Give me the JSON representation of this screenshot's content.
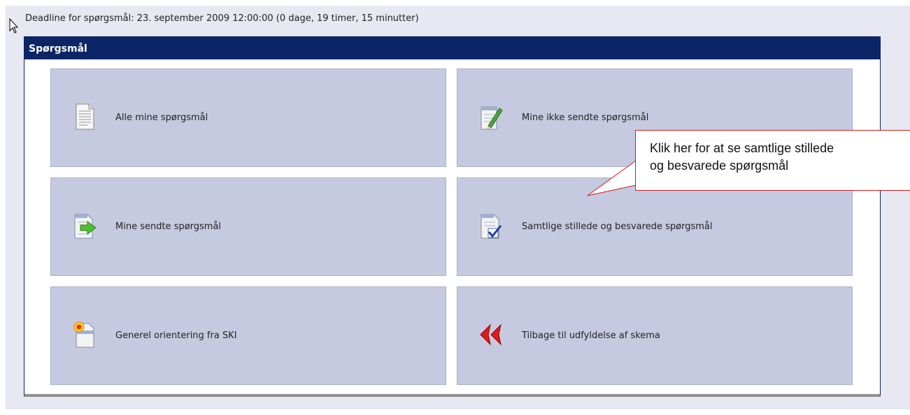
{
  "deadline_text": "Deadline for spørgsmål: 23. september 2009 12:00:00 (0 dage, 19 timer, 15 minutter)",
  "panel": {
    "title": "Spørgsmål"
  },
  "tiles": [
    {
      "label": "Alle mine spørgsmål",
      "icon": "document-icon"
    },
    {
      "label": "Mine ikke sendte spørgsmål",
      "icon": "edit-document-icon"
    },
    {
      "label": "Mine sendte spørgsmål",
      "icon": "send-document-icon"
    },
    {
      "label": "Samtlige stillede og besvarede spørgsmål",
      "icon": "checked-document-icon"
    },
    {
      "label": "Generel orientering fra SKI",
      "icon": "new-document-icon"
    },
    {
      "label": "Tilbage til udfyldelse af skema",
      "icon": "back-arrows-icon"
    }
  ],
  "callout": {
    "line1": "Klik her for at se samtlige stillede",
    "line2": "og besvarede spørgsmål"
  },
  "colors": {
    "header": "#0b2566",
    "tile": "#c6cae0",
    "background": "#e7e8f2",
    "callout_border": "#d01f1f"
  }
}
